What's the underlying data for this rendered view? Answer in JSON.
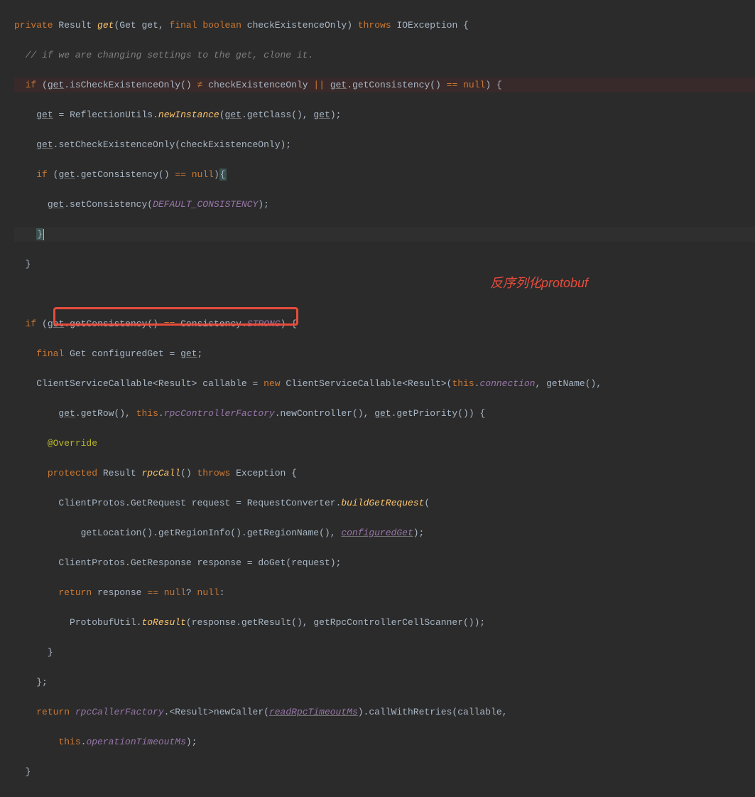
{
  "annotation_label": "反序列化protobuf",
  "code": {
    "l1": {
      "k_private": "private",
      "t_Result": "Result",
      "m_get": "get",
      "t_Get": "Get",
      "p_get": "get",
      "k_final": "final",
      "k_boolean": "boolean",
      "p_check": "checkExistenceOnly",
      "k_throws": "throws",
      "t_IO": "IOException"
    },
    "l2": {
      "comment": "// if we are changing settings to the get, clone it."
    },
    "l3": {
      "k_if": "if",
      "v_get": "get",
      "m_isCheck": "isCheckExistenceOnly",
      "op_ne": "≠",
      "v_check": "checkExistenceOnly",
      "op_or": "||",
      "m_getCons": "getConsistency",
      "op_eq": "==",
      "k_null": "null"
    },
    "l4": {
      "v_get": "get",
      "t_RU": "ReflectionUtils",
      "m_newInst": "newInstance",
      "m_getClass": "getClass"
    },
    "l5": {
      "v_get": "get",
      "m_setCheck": "setCheckExistenceOnly",
      "v_check": "checkExistenceOnly"
    },
    "l6": {
      "k_if": "if",
      "v_get": "get",
      "m_getCons": "getConsistency",
      "op_eq": "==",
      "k_null": "null"
    },
    "l7": {
      "v_get": "get",
      "m_setCons": "setConsistency",
      "c_DEFAULT": "DEFAULT_CONSISTENCY"
    },
    "l10": {
      "k_if": "if",
      "v_get": "get",
      "m_getCons": "getConsistency",
      "op_eq": "==",
      "t_Cons": "Consistency",
      "c_STRONG": "STRONG"
    },
    "l11": {
      "k_final": "final",
      "t_Get": "Get",
      "v_cfg": "configuredGet",
      "v_get": "get"
    },
    "l12": {
      "t_CSC": "ClientServiceCallable",
      "t_Result": "Result",
      "v_call": "callable",
      "k_new": "new",
      "k_this": "this",
      "f_conn": "connection",
      "m_getName": "getName"
    },
    "l13": {
      "v_get": "get",
      "m_getRow": "getRow",
      "k_this": "this",
      "f_rpc": "rpcControllerFactory",
      "m_newCtrl": "newController",
      "m_getPrio": "getPriority"
    },
    "l14": {
      "a_Override": "@Override"
    },
    "l15": {
      "k_protected": "protected",
      "t_Result": "Result",
      "m_rpcCall": "rpcCall",
      "k_throws": "throws",
      "t_Ex": "Exception"
    },
    "l16": {
      "t_CP": "ClientProtos",
      "t_GetReq": "GetRequest",
      "v_req": "request",
      "t_RC": "RequestConverter",
      "m_build": "buildGetRequest"
    },
    "l17": {
      "m_getLoc": "getLocation",
      "m_getRI": "getRegionInfo",
      "m_getRN": "getRegionName",
      "v_cfg": "configuredGet"
    },
    "l18": {
      "t_CP": "ClientProtos",
      "t_GetResp": "GetResponse",
      "v_resp": "response",
      "m_doGet": "doGet",
      "v_req": "request"
    },
    "l19": {
      "k_return": "return",
      "v_resp": "response",
      "op_eq": "==",
      "k_null": "null",
      "k_null2": "null"
    },
    "l20": {
      "t_PU": "ProtobufUtil",
      "m_toRes": "toResult",
      "v_resp": "response",
      "m_getRes": "getResult",
      "m_getScan": "getRpcControllerCellScanner"
    },
    "l23": {
      "k_return": "return",
      "f_rcf": "rpcCallerFactory",
      "t_Result": "Result",
      "m_newCaller": "newCaller",
      "v_rto": "readRpcTimeoutMs",
      "m_cwr": "callWithRetries",
      "v_call": "callable"
    },
    "l24": {
      "k_this": "this",
      "f_oto": "operationTimeoutMs"
    }
  }
}
